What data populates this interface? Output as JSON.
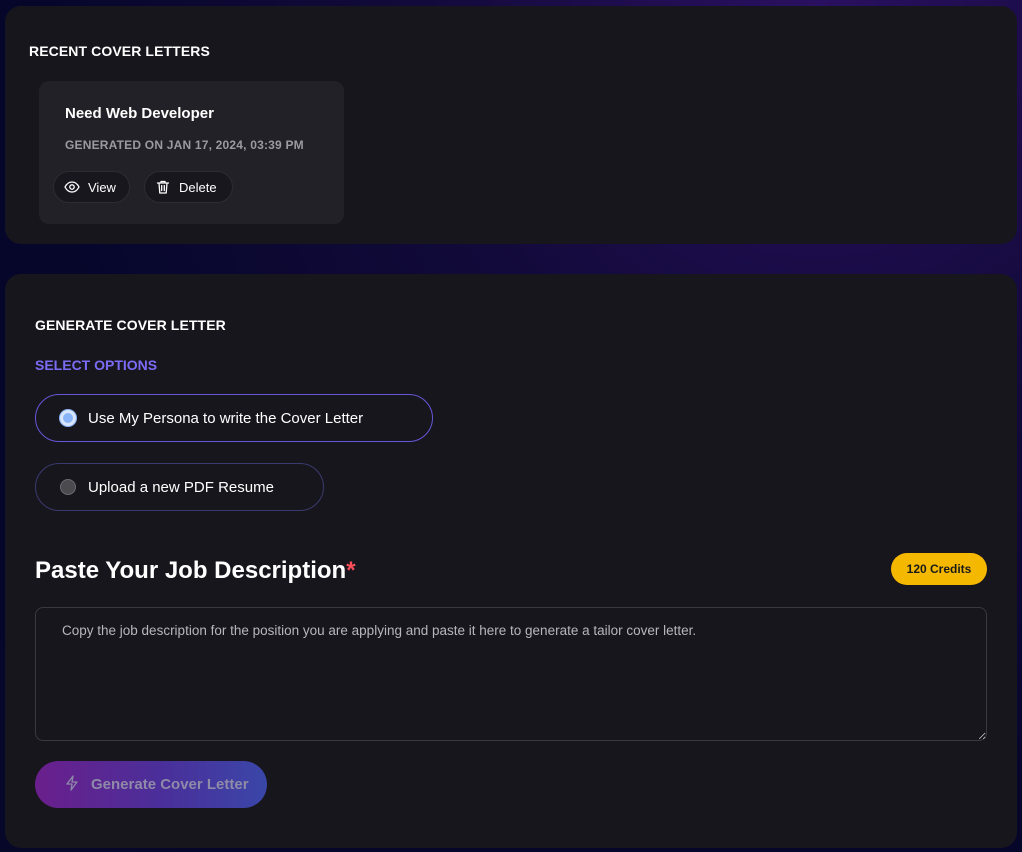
{
  "recent": {
    "title": "RECENT COVER LETTERS",
    "card": {
      "title": "Need Web Developer",
      "meta": "GENERATED ON JAN 17, 2024, 03:39 PM",
      "view_label": "View",
      "delete_label": "Delete"
    }
  },
  "generate": {
    "title": "GENERATE COVER LETTER",
    "select_options_label": "SELECT OPTIONS",
    "options": [
      {
        "label": "Use My Persona to write the Cover Letter",
        "selected": true
      },
      {
        "label": "Upload a new PDF Resume",
        "selected": false
      }
    ],
    "job_heading": "Paste Your Job Description",
    "required_mark": "*",
    "credits_label": "120 Credits",
    "textarea_placeholder": "Copy the job description for the position you are applying and paste it here to generate a tailor cover letter.",
    "textarea_value": "",
    "generate_button_label": "Generate Cover Letter"
  },
  "colors": {
    "accent": "#7b6cf6",
    "credits": "#f5b800",
    "required": "#ff4d5a",
    "radio_on": "#8ab4f8"
  },
  "icons": {
    "view": "eye-icon",
    "delete": "trash-icon",
    "generate": "lightning-icon"
  }
}
